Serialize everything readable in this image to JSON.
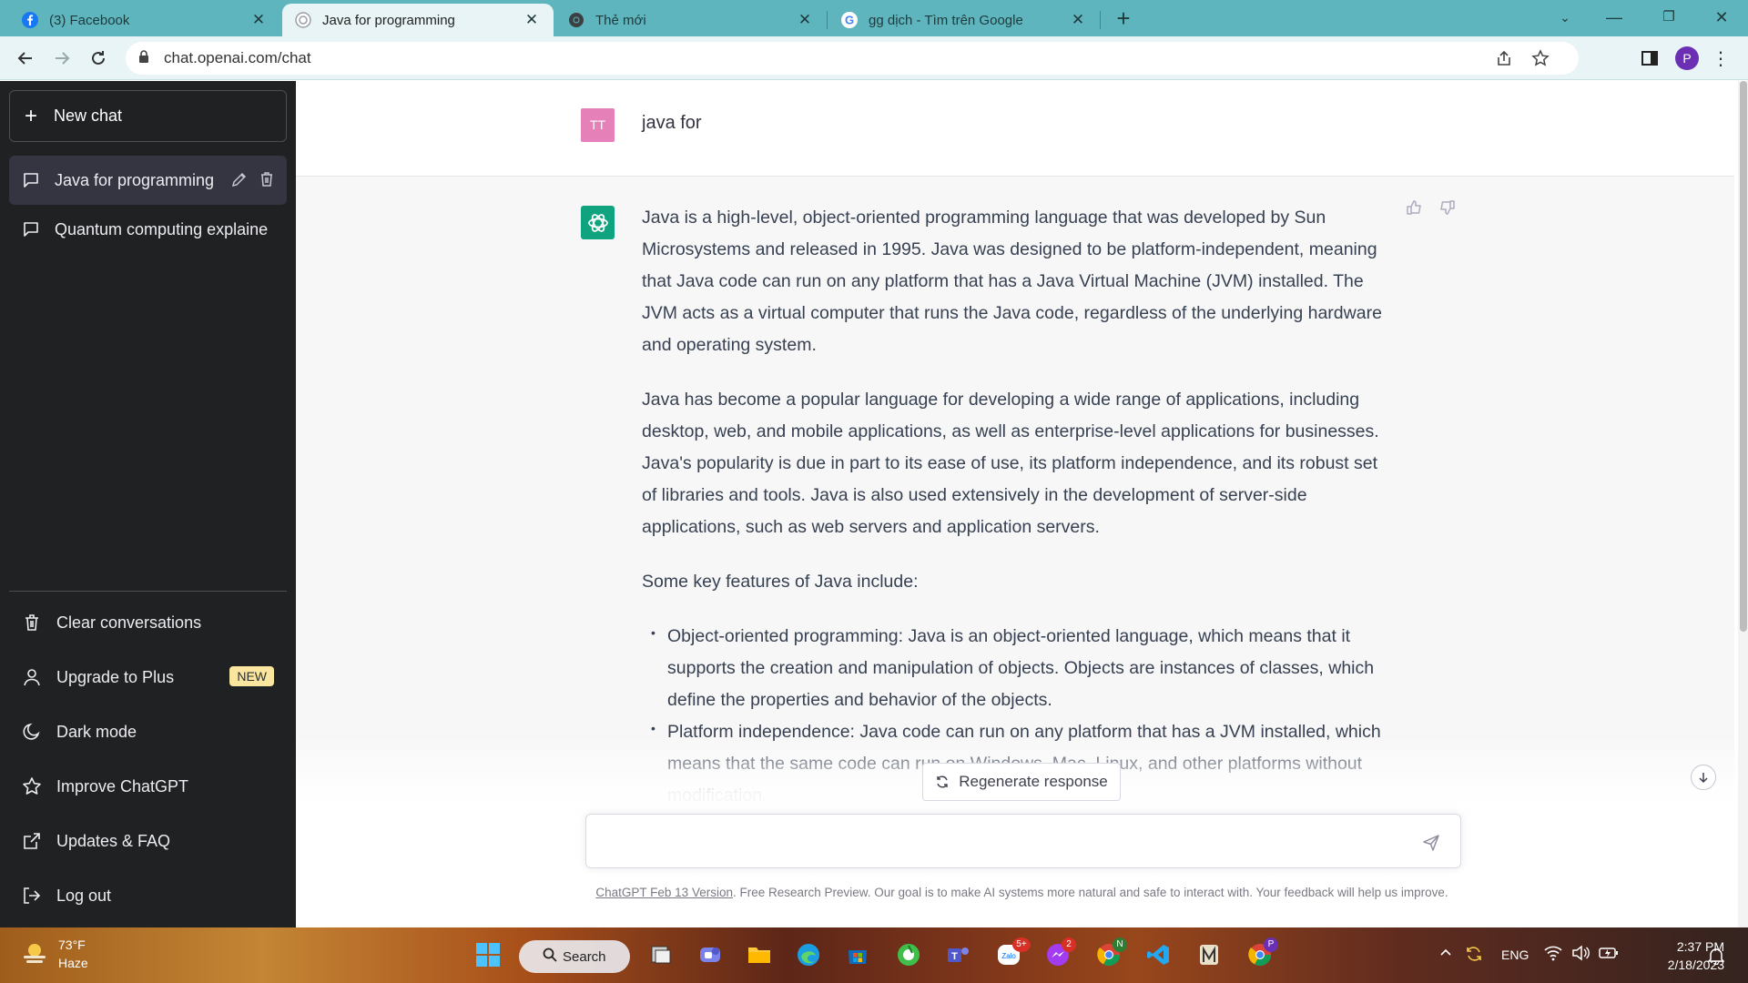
{
  "browser": {
    "tabs": [
      {
        "title": "(3) Facebook",
        "icon": "facebook-icon"
      },
      {
        "title": "Java for programming",
        "icon": "chatgpt-icon",
        "active": true
      },
      {
        "title": "Thẻ mới",
        "icon": "chrome-icon"
      },
      {
        "title": "gg dịch - Tìm trên Google",
        "icon": "google-icon"
      }
    ],
    "url": "chat.openai.com/chat",
    "profile_initial": "P"
  },
  "sidebar": {
    "new_chat": "New chat",
    "conversations": [
      {
        "label": "Java for programming",
        "selected": true
      },
      {
        "label": "Quantum computing explaine",
        "selected": false
      }
    ],
    "menu": [
      {
        "label": "Clear conversations",
        "icon": "trash-icon"
      },
      {
        "label": "Upgrade to Plus",
        "icon": "user-icon",
        "badge": "NEW"
      },
      {
        "label": "Dark mode",
        "icon": "moon-icon"
      },
      {
        "label": "Improve ChatGPT",
        "icon": "star-icon"
      },
      {
        "label": "Updates & FAQ",
        "icon": "external-link-icon"
      },
      {
        "label": "Log out",
        "icon": "logout-icon"
      }
    ]
  },
  "chat": {
    "user_avatar": "TT",
    "user_message": "java for",
    "answer": {
      "p1": "Java is a high-level, object-oriented programming language that was developed by Sun Microsystems and released in 1995. Java was designed to be platform-independent, meaning that Java code can run on any platform that has a Java Virtual Machine (JVM) installed. The JVM acts as a virtual computer that runs the Java code, regardless of the underlying hardware and operating system.",
      "p2": "Java has become a popular language for developing a wide range of applications, including desktop, web, and mobile applications, as well as enterprise-level applications for businesses. Java's popularity is due in part to its ease of use, its platform independence, and its robust set of libraries and tools. Java is also used extensively in the development of server-side applications, such as web servers and application servers.",
      "p3": "Some key features of Java include:",
      "bullets": [
        "Object-oriented programming: Java is an object-oriented language, which means that it supports the creation and manipulation of objects. Objects are instances of classes, which define the properties and behavior of the objects.",
        "Platform independence: Java code can run on any platform that has a JVM installed, which means that the same code can run on Windows, Mac, Linux, and other platforms without modification."
      ]
    },
    "regenerate": "Regenerate response",
    "input_placeholder": "",
    "footer_link": "ChatGPT Feb 13 Version",
    "footer_text": ". Free Research Preview. Our goal is to make AI systems more natural and safe to interact with. Your feedback will help us improve."
  },
  "taskbar": {
    "weather_temp": "73°F",
    "weather_cond": "Haze",
    "search_label": "Search",
    "badges": {
      "zalo": "5+",
      "messenger": "2",
      "chrome_n": "N",
      "chrome_p": "P"
    },
    "language": "ENG",
    "time": "2:37 PM",
    "date": "2/18/2023"
  },
  "colors": {
    "tabbar": "#5fb5bd",
    "sidebar": "#202123",
    "gpt_green": "#10a37f",
    "user_avatar": "#e580b8",
    "badge_new": "#fae69e"
  }
}
